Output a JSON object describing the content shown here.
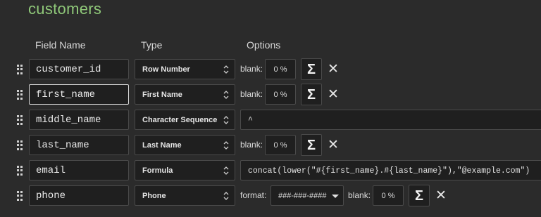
{
  "schema_title": "customers",
  "headers": {
    "field_name": "Field Name",
    "type": "Type",
    "options": "Options"
  },
  "rows": [
    {
      "field_name": "customer_id",
      "type": "Row Number",
      "blank_label": "blank:",
      "blank_value": "0 %",
      "sum_glyph": "Σ",
      "remove_glyph": "✕"
    },
    {
      "field_name": "first_name",
      "type": "First Name",
      "blank_label": "blank:",
      "blank_value": "0 %",
      "sum_glyph": "Σ",
      "remove_glyph": "✕"
    },
    {
      "field_name": "middle_name",
      "type": "Character Sequence",
      "option_value": "^"
    },
    {
      "field_name": "last_name",
      "type": "Last Name",
      "blank_label": "blank:",
      "blank_value": "0 %",
      "sum_glyph": "Σ",
      "remove_glyph": "✕"
    },
    {
      "field_name": "email",
      "type": "Formula",
      "option_value": "concat(lower(\"#{first_name}.#{last_name}\"),\"@example.com\")"
    },
    {
      "field_name": "phone",
      "type": "Phone",
      "format_label": "format:",
      "format_value": "###-###-####",
      "blank_label": "blank:",
      "blank_value": "0 %",
      "sum_glyph": "Σ",
      "remove_glyph": "✕"
    }
  ],
  "icons": {
    "drag": "drag-handle-icon",
    "updown": "updown-arrows-icon",
    "caret": "caret-down-icon"
  },
  "colors": {
    "background": "#2b2b2b",
    "title": "#8fc879",
    "input_bg": "#1f1f1f",
    "input_border": "#4a4a4a"
  }
}
